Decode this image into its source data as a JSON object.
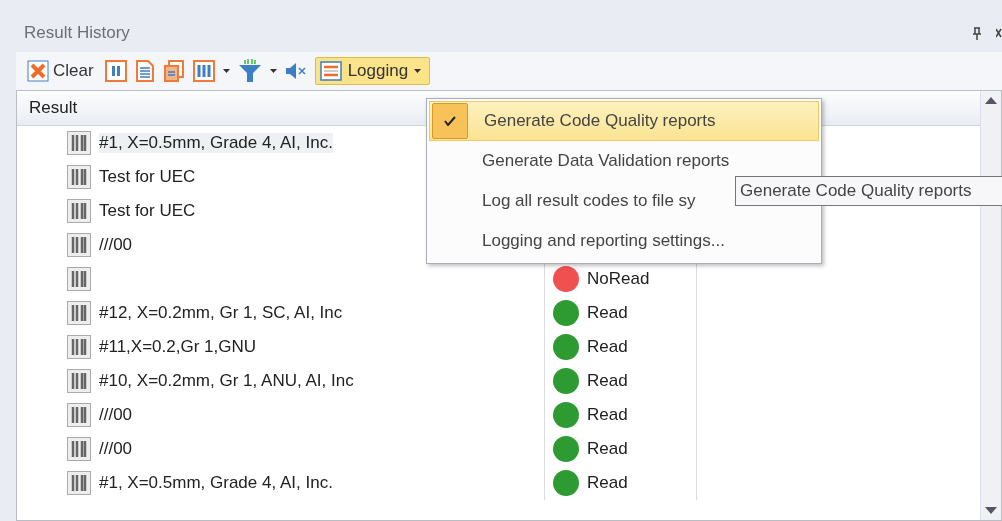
{
  "panel": {
    "title": "Result History"
  },
  "toolbar": {
    "clear_label": "Clear",
    "logging_label": "Logging",
    "logging_open": true
  },
  "table": {
    "columns": [
      "Result"
    ],
    "rows": [
      {
        "result": "#1, X=0.5mm, Grade 4, AI, Inc.",
        "selected": true
      },
      {
        "result": "Test for UEC",
        "selected": false
      },
      {
        "result": "Test for UEC",
        "selected": false
      },
      {
        "result": "///00",
        "selected": false
      },
      {
        "result": "",
        "selected": false,
        "status": "NoRead",
        "color": "#f05050"
      },
      {
        "result": "#12, X=0.2mm, Gr 1, SC, AI, Inc",
        "selected": false,
        "status": "Read",
        "color": "#2e9a32"
      },
      {
        "result": "#11,X=0.2,Gr 1,GNU",
        "selected": false,
        "status": "Read",
        "color": "#2e9a32"
      },
      {
        "result": "#10, X=0.2mm, Gr 1, ANU, AI, Inc",
        "selected": false,
        "status": "Read",
        "color": "#2e9a32"
      },
      {
        "result": "///00",
        "selected": false,
        "status": "Read",
        "color": "#2e9a32"
      },
      {
        "result": "///00",
        "selected": false,
        "status": "Read",
        "color": "#2e9a32"
      },
      {
        "result": "#1, X=0.5mm, Grade 4, AI, Inc.",
        "selected": false,
        "status": "Read",
        "color": "#2e9a32"
      }
    ]
  },
  "menu": {
    "items": [
      {
        "label": "Generate Code Quality reports",
        "checked": true,
        "selected": true
      },
      {
        "label": "Generate Data Validation reports",
        "checked": false,
        "selected": false
      },
      {
        "label": "Log all result codes to file sy",
        "checked": false,
        "selected": false
      },
      {
        "label": "Logging and reporting settings...",
        "checked": false,
        "selected": false
      }
    ]
  },
  "tooltip": {
    "text": "Generate Code Quality reports"
  }
}
